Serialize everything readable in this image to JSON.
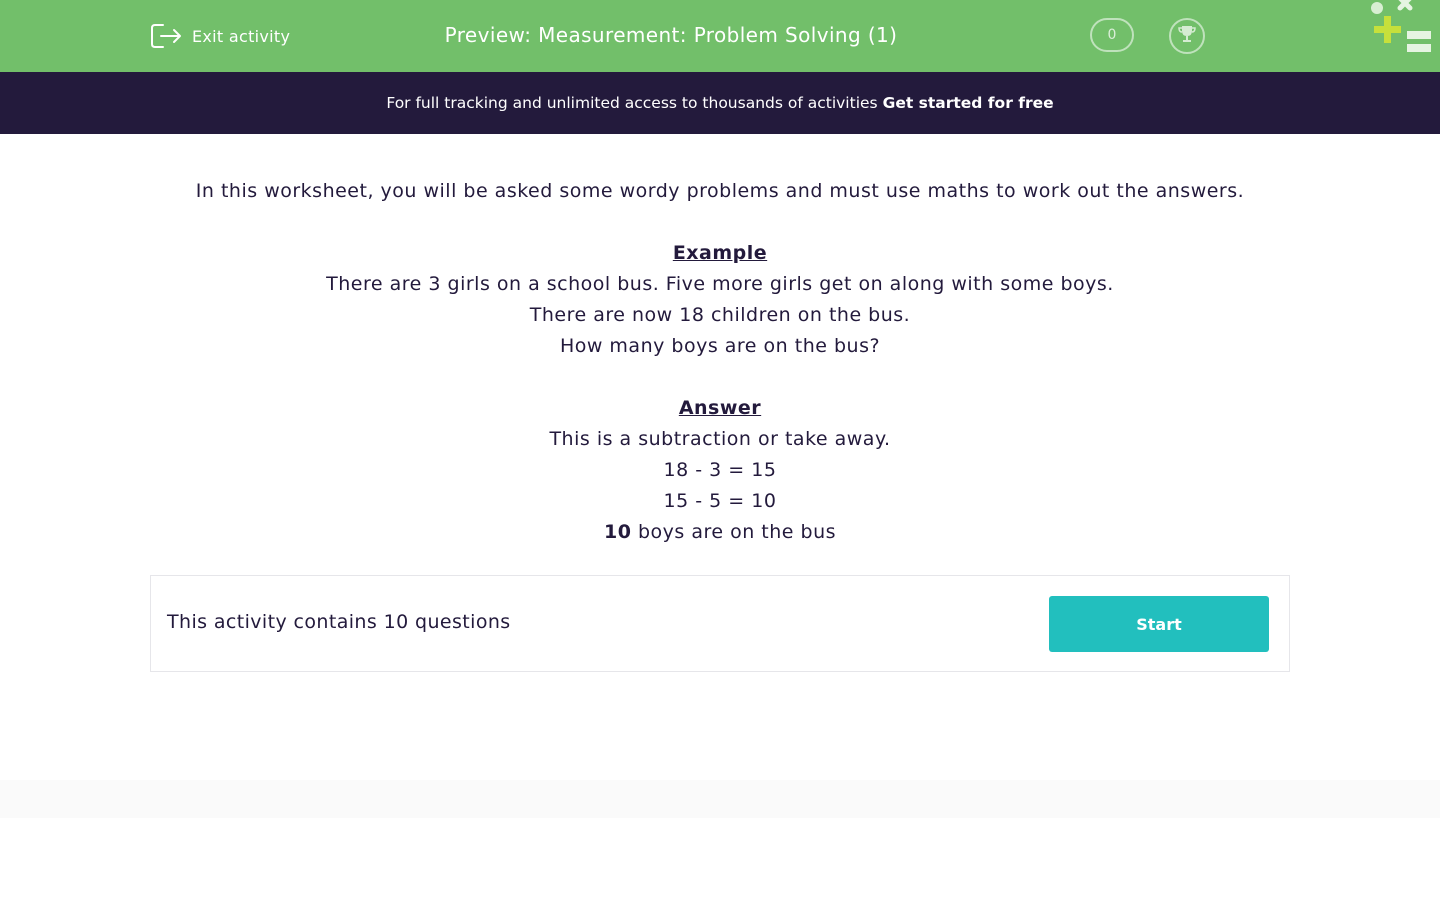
{
  "header": {
    "exit_label": "Exit activity",
    "exit_icon": "exit-icon",
    "title": "Preview: Measurement: Problem Solving (1)",
    "score": "0",
    "trophy_icon": "trophy-icon",
    "logo_icon": "maths-symbols-logo-icon"
  },
  "promo": {
    "text": "For full tracking and unlimited access to thousands of activities",
    "link": "Get started for free"
  },
  "intro": "In this worksheet, you will be asked some wordy problems and must use maths to work out the answers.",
  "example": {
    "heading": "Example",
    "lines": [
      "There are 3 girls on a school bus.  Five more girls get on along with some boys.",
      "There are now 18 children on the bus.",
      "How many boys are on the bus?"
    ]
  },
  "answer": {
    "heading": "Answer",
    "lines": [
      "This is a subtraction or take away.",
      "18 - 3  = 15",
      "15 - 5 = 10"
    ],
    "final_number": "10",
    "final_text": " boys are on the bus"
  },
  "activity": {
    "question_count_text": "This activity contains 10 questions",
    "start_label": "Start"
  },
  "colors": {
    "header_green": "#72bf6a",
    "promo_dark": "#231a3c",
    "start_teal": "#22bfbe",
    "logo_accent": "#c6e03b"
  }
}
